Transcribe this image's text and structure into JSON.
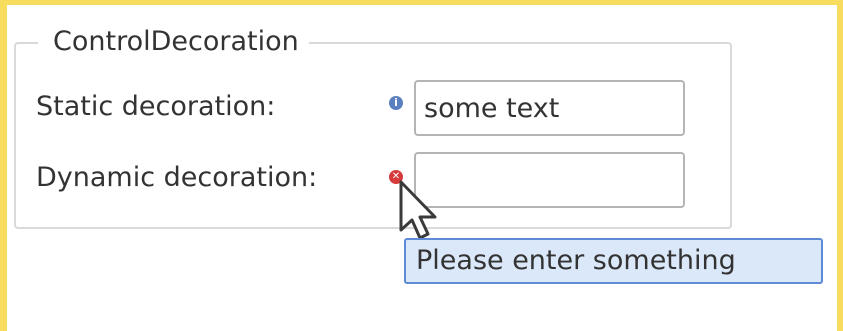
{
  "group": {
    "title": "ControlDecoration"
  },
  "static_row": {
    "label": "Static decoration:",
    "icon": "info-icon",
    "value": "some text"
  },
  "dynamic_row": {
    "label": "Dynamic decoration:",
    "icon": "error-icon",
    "value": "",
    "tooltip": "Please enter something"
  },
  "colors": {
    "frame": "#f7dc5e",
    "info": "#5b7fbf",
    "error": "#d63a3a",
    "tooltip_bg": "#dbe8f9",
    "tooltip_border": "#5f8ad6"
  }
}
